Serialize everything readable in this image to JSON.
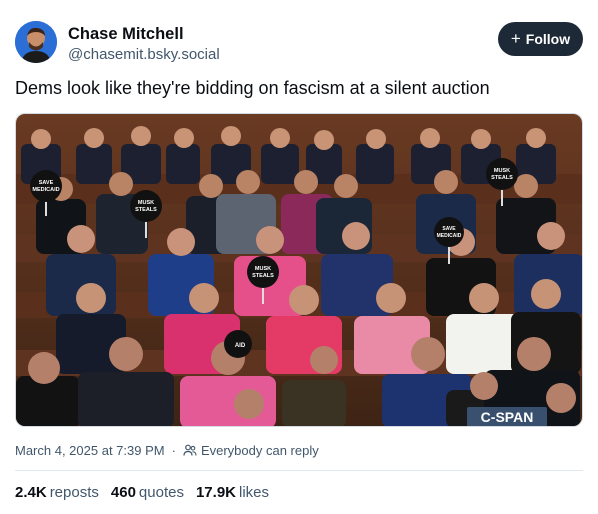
{
  "author": {
    "display_name": "Chase Mitchell",
    "handle": "@chasemit.bsky.social"
  },
  "follow_button": {
    "label": "Follow",
    "icon": "plus-icon"
  },
  "post": {
    "text": "Dems look like they're bidding on fascism at a silent auction"
  },
  "media": {
    "signs": [
      "SAVE MEDICAID",
      "MUSK STEALS",
      "MUSK STEALS",
      "SAVE MEDICAID",
      "MUSK STEALS",
      "AID"
    ],
    "watermark": "C-SPAN"
  },
  "meta": {
    "timestamp": "March 4, 2025 at 7:39 PM",
    "separator": "·",
    "reply_setting": "Everybody can reply",
    "reply_icon": "people-icon"
  },
  "stats": [
    {
      "value": "2.4K",
      "label": "reposts"
    },
    {
      "value": "460",
      "label": "quotes"
    },
    {
      "value": "17.9K",
      "label": "likes"
    }
  ],
  "colors": {
    "follow_bg": "#1e2937",
    "muted_text": "#42576c",
    "avatar_bg": "#2b6fd6"
  }
}
